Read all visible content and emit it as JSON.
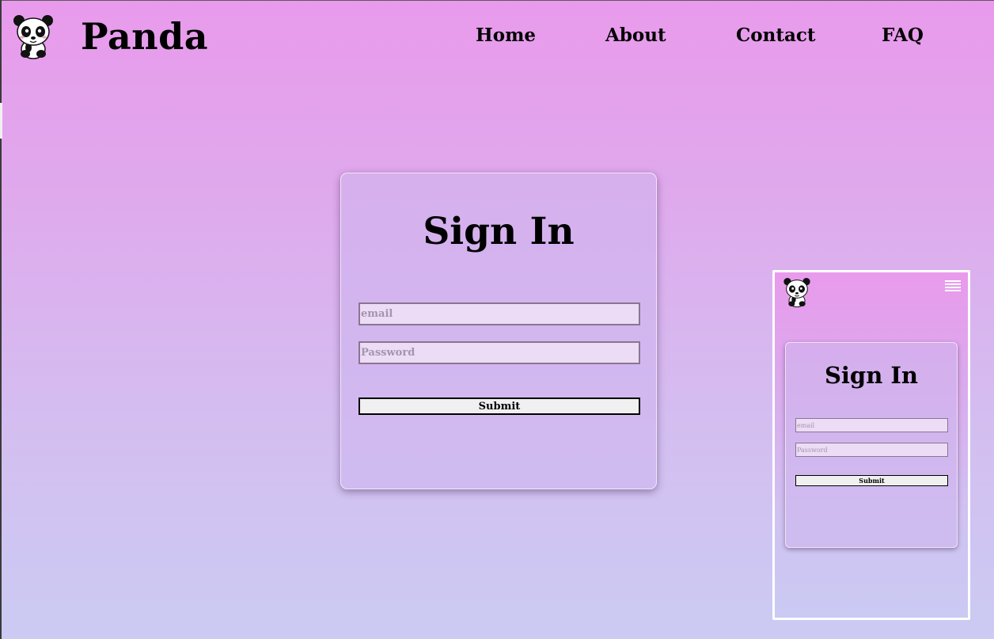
{
  "header": {
    "logo_icon": "panda-icon",
    "brand": "Panda",
    "nav": [
      {
        "label": "Home"
      },
      {
        "label": "About"
      },
      {
        "label": "Contact"
      },
      {
        "label": "FAQ"
      }
    ]
  },
  "signin": {
    "title": "Sign In",
    "email_placeholder": "email",
    "password_placeholder": "Password",
    "submit_label": "Submit"
  },
  "mobile_preview": {
    "logo_icon": "panda-icon",
    "menu_icon": "hamburger-menu-icon",
    "title": "Sign In",
    "email_placeholder": "email",
    "password_placeholder": "Password",
    "submit_label": "Submit"
  },
  "colors": {
    "background_top": "#e99aec",
    "background_bottom": "#cbcbf3",
    "input_fill": "#ecdcf5",
    "button_fill": "#f0f0f0"
  }
}
